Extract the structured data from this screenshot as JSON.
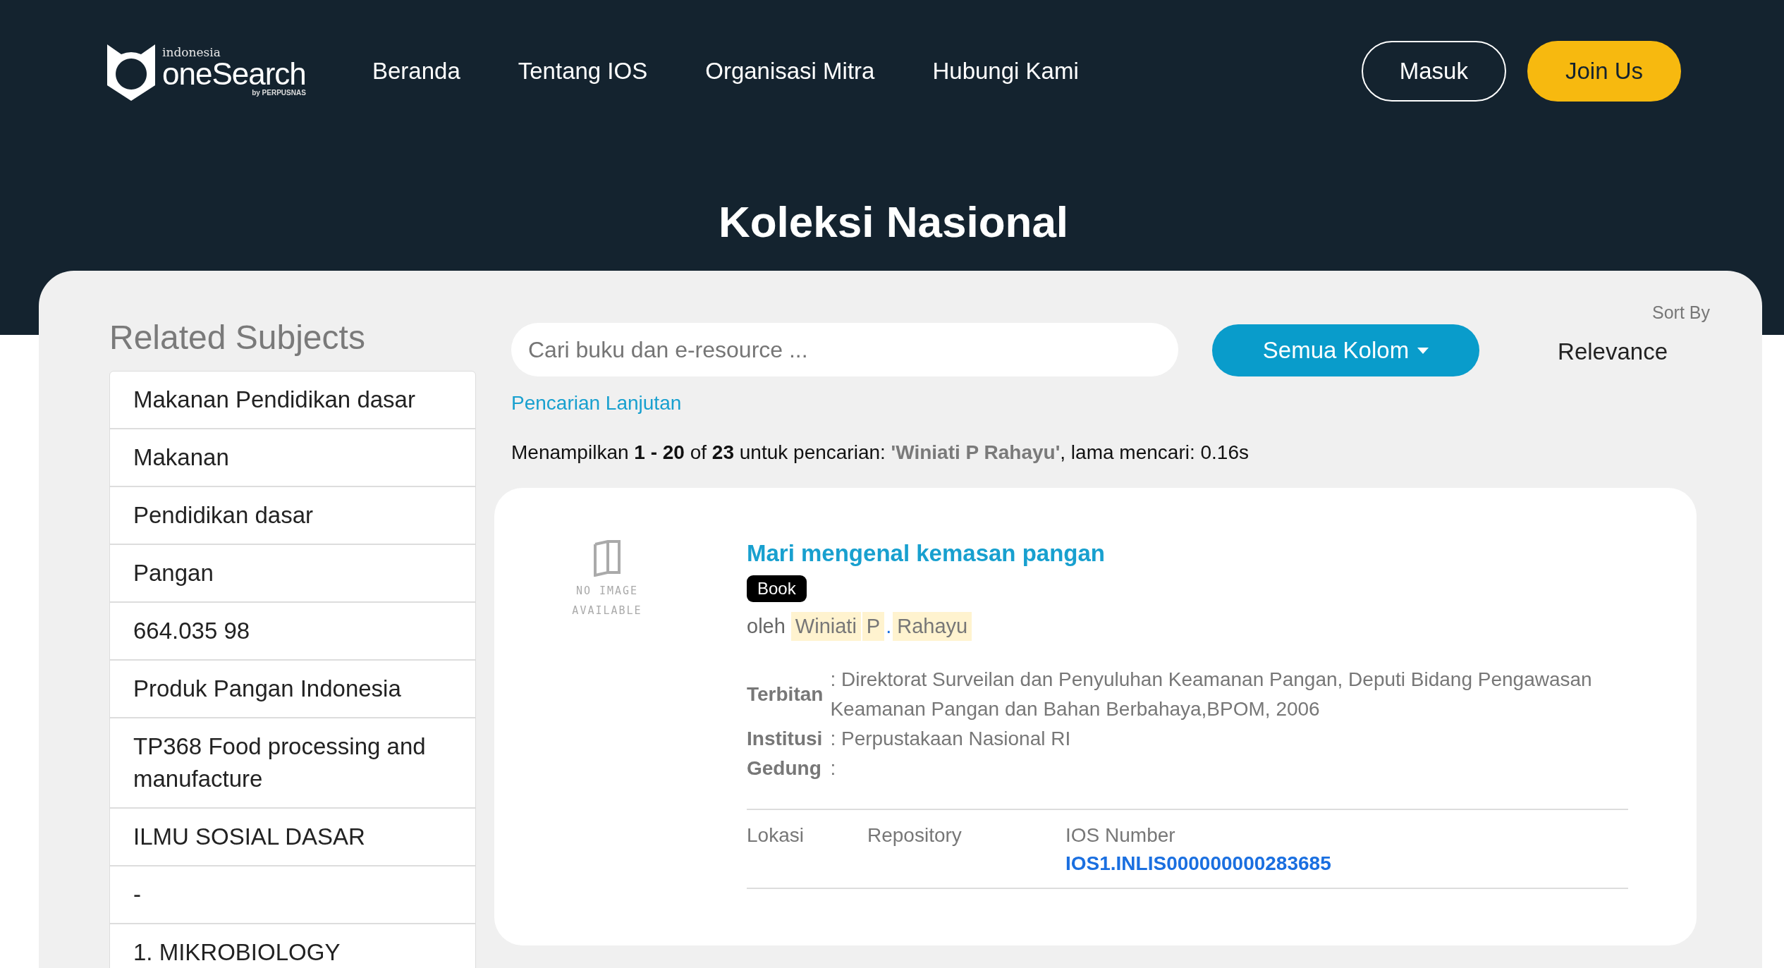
{
  "header": {
    "logo": {
      "top": "indonesia",
      "main": "oneSearch",
      "by": "by PERPUSNAS"
    },
    "nav": [
      "Beranda",
      "Tentang IOS",
      "Organisasi Mitra",
      "Hubungi Kami"
    ],
    "actions": [
      {
        "label": "Masuk",
        "kind": "outline"
      },
      {
        "label": "Join Us",
        "kind": "primary"
      }
    ]
  },
  "page_title": "Koleksi Nasional",
  "related_subjects": {
    "title": "Related Subjects",
    "items": [
      "Makanan Pendidikan dasar",
      "Makanan",
      "Pendidikan dasar",
      "Pangan",
      "664.035 98",
      "Produk Pangan Indonesia",
      "TP368 Food processing and manufacture",
      "ILMU SOSIAL DASAR",
      "-",
      "1. MIKROBIOLOGY"
    ]
  },
  "search": {
    "placeholder": "Cari buku dan e-resource ...",
    "column_button": "Semua Kolom",
    "sort_label": "Sort By",
    "sort_value": "Relevance",
    "advanced_link": "Pencarian Lanjutan"
  },
  "summary": "Menampilkan **1 - 20** of **23** untuk pencarian: **'Winiati P Rahayu'**, lama mencari: 0.16s",
  "results": [
    {
      "image_text": "NO IMAGE AVAILABLE",
      "title": "Mari mengenal kemasan pangan",
      "type": "Book",
      "by_label": "oleh",
      "authors": [
        {
          "text": "Winiati",
          "highlighted": true
        },
        {
          "text": "P",
          "highlighted": true
        },
        {
          "text": ".",
          "highlighted": false
        },
        {
          "text": "Rahayu",
          "highlighted": true
        }
      ],
      "fields": [
        {
          "label": "Terbitan",
          "value": ": Direktorat Surveilan dan Penyuluhan Keamanan Pangan, Deputi Bidang Pengawasan Keamanan Pangan dan Bahan Berbahaya,BPOM, 2006"
        },
        {
          "label": "Institusi",
          "value": ": Perpustakaan Nasional RI"
        },
        {
          "label": "Gedung",
          "value": ":"
        }
      ],
      "holdings": {
        "columns": [
          "Lokasi",
          "Repository",
          "IOS Number"
        ],
        "ios_number": "IOS1.INLIS000000000283685"
      }
    }
  ]
}
